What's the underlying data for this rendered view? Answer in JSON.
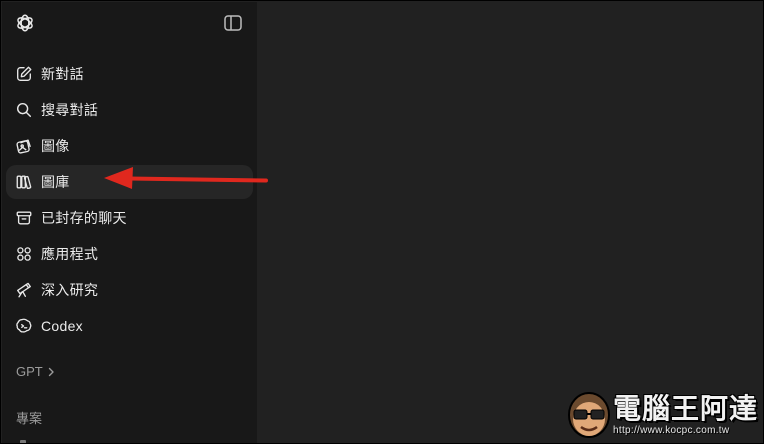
{
  "sidebar": {
    "items": [
      {
        "label": "新對話",
        "icon": "edit-icon"
      },
      {
        "label": "搜尋對話",
        "icon": "search-icon"
      },
      {
        "label": "圖像",
        "icon": "image-icon"
      },
      {
        "label": "圖庫",
        "icon": "library-icon",
        "active": true
      },
      {
        "label": "已封存的聊天",
        "icon": "archive-icon"
      },
      {
        "label": "應用程式",
        "icon": "apps-icon"
      },
      {
        "label": "深入研究",
        "icon": "telescope-icon"
      },
      {
        "label": "Codex",
        "icon": "codex-icon"
      }
    ],
    "gpt_label": "GPT",
    "projects_label": "專案"
  },
  "annotation": {
    "arrow_color": "#e0281e"
  },
  "watermark": {
    "title": "電腦王阿達",
    "url": "http://www.kocpc.com.tw"
  },
  "colors": {
    "sidebar_bg": "#181818",
    "main_bg": "#212121",
    "active_item_bg": "#262626",
    "text": "#ececec",
    "muted_text": "#9b9b9b"
  }
}
